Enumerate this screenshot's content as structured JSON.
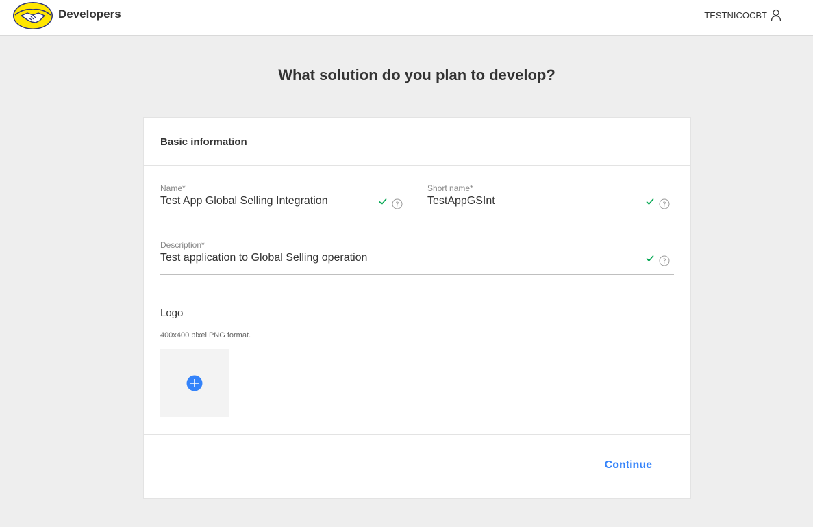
{
  "header": {
    "brand_name": "Developers",
    "user_name": "TESTNICOCBT"
  },
  "page": {
    "title": "What solution do you plan to develop?"
  },
  "form": {
    "section_title": "Basic information",
    "name": {
      "label": "Name*",
      "value": "Test App Global Selling Integration"
    },
    "short_name": {
      "label": "Short name*",
      "value": "TestAppGSInt"
    },
    "description": {
      "label": "Description*",
      "value": "Test application to Global Selling operation"
    },
    "logo": {
      "title": "Logo",
      "hint": "400x400 pixel PNG format."
    },
    "continue_label": "Continue"
  },
  "colors": {
    "accent": "#3483fa",
    "success": "#00a650",
    "brand_yellow": "#ffe600",
    "brand_blue": "#2d3277"
  },
  "icons": [
    "handshake-logo-icon",
    "user-icon",
    "check-icon",
    "help-icon",
    "plus-icon"
  ]
}
